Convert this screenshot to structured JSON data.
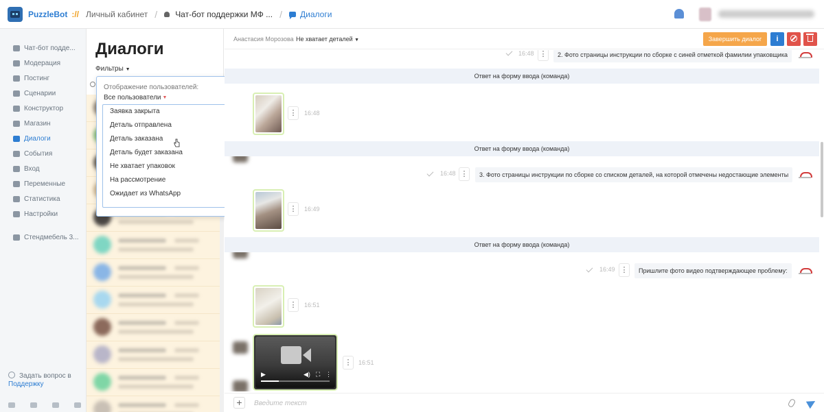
{
  "topbar": {
    "brand": "PuzzleBot",
    "brand_sep": "://",
    "crumb_cabinet": "Личный кабинет",
    "crumb_bot": "Чат-бот поддержки МФ ...",
    "crumb_active": "Диалоги"
  },
  "sidebar": {
    "items": [
      {
        "label": "Чат-бот подде...",
        "icon": "bot-icon"
      },
      {
        "label": "Модерация",
        "icon": "users-icon"
      },
      {
        "label": "Постинг",
        "icon": "send-icon"
      },
      {
        "label": "Сценарии",
        "icon": "script-icon"
      },
      {
        "label": "Конструктор",
        "icon": "grid-icon"
      },
      {
        "label": "Магазин",
        "icon": "cart-icon"
      },
      {
        "label": "Диалоги",
        "icon": "chat-icon"
      },
      {
        "label": "События",
        "icon": "star-icon"
      },
      {
        "label": "Вход",
        "icon": "login-icon"
      },
      {
        "label": "Переменные",
        "icon": "variables-icon"
      },
      {
        "label": "Статистика",
        "icon": "stats-icon"
      },
      {
        "label": "Настройки",
        "icon": "gear-icon"
      }
    ],
    "workspace": "Стендмебель 3...",
    "help_text": "Задать вопрос в",
    "help_link": "Поддержку"
  },
  "dialogs": {
    "title": "Диалоги",
    "filters_label": "Фильтры"
  },
  "filter_popup": {
    "label": "Отображение пользователей:",
    "value": "Все пользователи",
    "options": [
      "Заявка закрыта",
      "Деталь отправлена",
      "Деталь заказана",
      "Деталь будет заказана",
      "Не хватает упаковок",
      "На рассмотрение",
      "Ожидает из WhatsApp"
    ]
  },
  "chat": {
    "user_name": "Анастасия Морозова",
    "status": "Не хватает деталей",
    "finish_button": "Завершить диалог",
    "info_button": "i",
    "messages": {
      "m1_text": "2. Фото страницы инструкции по сборке с синей отметкой фамилии упаковщика",
      "m1_time": "16:48",
      "sys1": "Ответ на форму ввода (команда)",
      "p1_time": "16:48",
      "sys2": "Ответ на форму ввода (команда)",
      "m2_text": "3. Фото страницы инструкции по сборке со списком деталей, на которой отмечены недостающие элементы",
      "m2_time": "16:48",
      "p2_time": "16:49",
      "sys3": "Ответ на форму ввода (команда)",
      "m3_text": "Пришлите фото видео подтверждающее проблему:",
      "m3_time": "16:49",
      "p3_time": "16:51",
      "v_time": "16:51"
    },
    "input_placeholder": "Введите текст"
  },
  "colors": {
    "accent": "#2d7dd2",
    "finish": "#f5a64a",
    "danger": "#e0534a",
    "list_bg": "#fdf3df"
  }
}
